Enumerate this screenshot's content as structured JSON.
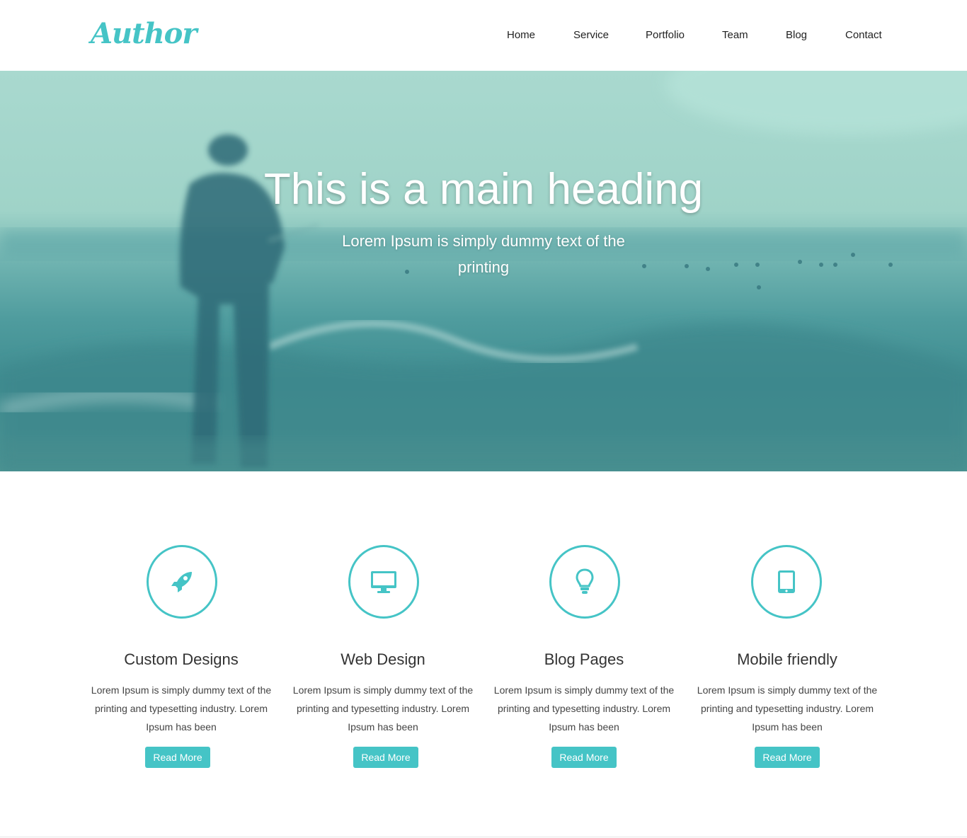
{
  "header": {
    "logo": "Author",
    "nav": [
      "Home",
      "Service",
      "Portfolio",
      "Team",
      "Blog",
      "Contact"
    ]
  },
  "hero": {
    "title": "This is a main heading",
    "subtitle": "Lorem Ipsum is simply dummy text of the printing"
  },
  "features": [
    {
      "icon": "rocket-icon",
      "title": "Custom Designs",
      "text": "Lorem Ipsum is simply dummy text of the printing and typesetting industry. Lorem Ipsum has been",
      "button": "Read More"
    },
    {
      "icon": "monitor-icon",
      "title": "Web Design",
      "text": "Lorem Ipsum is simply dummy text of the printing and typesetting industry. Lorem Ipsum has been",
      "button": "Read More"
    },
    {
      "icon": "lightbulb-icon",
      "title": "Blog Pages",
      "text": "Lorem Ipsum is simply dummy text of the printing and typesetting industry. Lorem Ipsum has been",
      "button": "Read More"
    },
    {
      "icon": "tablet-icon",
      "title": "Mobile friendly",
      "text": "Lorem Ipsum is simply dummy text of the printing and typesetting industry. Lorem Ipsum has been",
      "button": "Read More"
    }
  ],
  "colors": {
    "accent": "#45c4c6",
    "text": "#333333"
  }
}
